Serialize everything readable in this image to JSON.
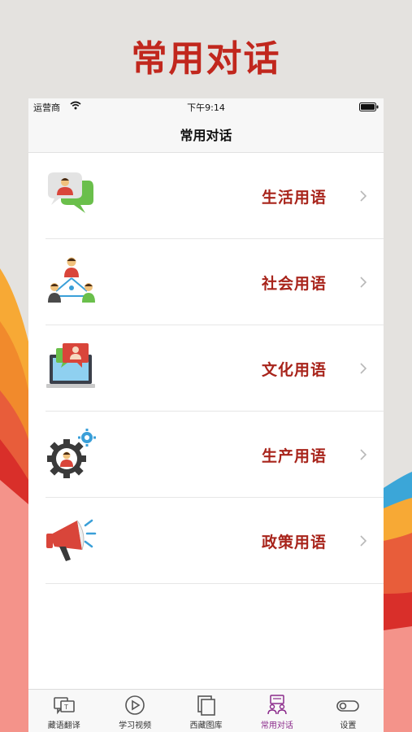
{
  "promo": {
    "title": "常用对话"
  },
  "status_bar": {
    "carrier": "运营商",
    "time": "下午9:14"
  },
  "nav": {
    "title": "常用对话"
  },
  "items": [
    {
      "label": "生活用语",
      "icon": "chat-bubbles-person-icon"
    },
    {
      "label": "社会用语",
      "icon": "people-network-icon"
    },
    {
      "label": "文化用语",
      "icon": "laptop-chat-icon"
    },
    {
      "label": "生产用语",
      "icon": "gear-person-icon"
    },
    {
      "label": "政策用语",
      "icon": "megaphone-icon"
    }
  ],
  "tabs": [
    {
      "label": "藏语翻译",
      "icon": "translate-icon",
      "active": false
    },
    {
      "label": "学习视频",
      "icon": "play-circle-icon",
      "active": false
    },
    {
      "label": "西藏图库",
      "icon": "gallery-icon",
      "active": false
    },
    {
      "label": "常用对话",
      "icon": "dialog-icon",
      "active": true
    },
    {
      "label": "设置",
      "icon": "toggle-settings-icon",
      "active": false
    }
  ],
  "colors": {
    "accent": "#a8241b",
    "promo_title": "#c1271d",
    "tab_active": "#8b2a8b"
  }
}
